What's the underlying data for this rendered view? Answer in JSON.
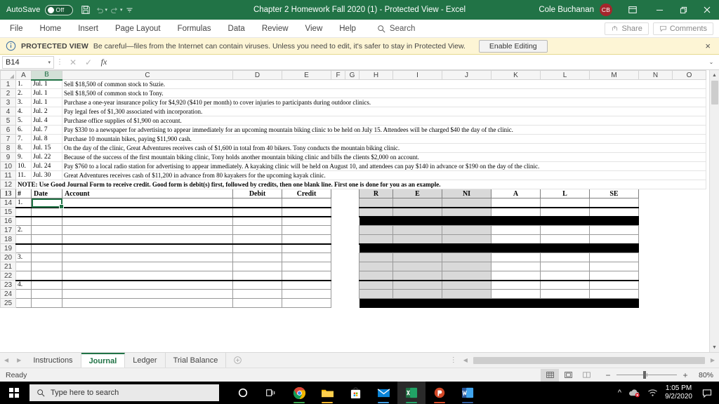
{
  "titlebar": {
    "autosave_label": "AutoSave",
    "autosave_state": "Off",
    "document_title": "Chapter 2 Homework Fall 2020 (1)  -  Protected View  -  Excel",
    "user_name": "Cole Buchanan",
    "user_initials": "CB",
    "icons": [
      "save-icon",
      "undo-icon",
      "redo-icon",
      "customize-quick-access-icon"
    ],
    "window_buttons": [
      "ribbon-display-options",
      "minimize",
      "restore",
      "close"
    ]
  },
  "menubar": {
    "items": [
      "File",
      "Home",
      "Insert",
      "Page Layout",
      "Formulas",
      "Data",
      "Review",
      "View",
      "Help"
    ],
    "search_label": "Search",
    "share_label": "Share",
    "comments_label": "Comments"
  },
  "protected_view": {
    "badge": "PROTECTED VIEW",
    "message": "Be careful—files from the Internet can contain viruses. Unless you need to edit, it's safer to stay in Protected View.",
    "button_label": "Enable Editing",
    "close_label": "×"
  },
  "formula_bar": {
    "name_box": "B14",
    "cancel": "✕",
    "enter": "✓",
    "function": "fx",
    "value": "",
    "placeholder": ""
  },
  "grid": {
    "columns": [
      "A",
      "B",
      "C",
      "D",
      "E",
      "F",
      "G",
      "H",
      "I",
      "J",
      "K",
      "L",
      "M",
      "N",
      "O"
    ],
    "selected_column": "B",
    "active_cell": "B14",
    "row_numbers": [
      1,
      2,
      3,
      4,
      5,
      6,
      7,
      8,
      9,
      10,
      11,
      12,
      13,
      14,
      15,
      16,
      17,
      18,
      19,
      20,
      21,
      22,
      23,
      24,
      25
    ],
    "transactions": [
      {
        "row": 1,
        "num": "1.",
        "date": "Jul. 1",
        "text": "Sell $18,500 of common stock to Suzie."
      },
      {
        "row": 2,
        "num": "2.",
        "date": "Jul. 1",
        "text": "Sell $18,500 of common stock to Tony."
      },
      {
        "row": 3,
        "num": "3.",
        "date": "Jul. 1",
        "text": "Purchase a one-year insurance policy for $4,920 ($410 per month) to cover injuries to participants during outdoor clinics."
      },
      {
        "row": 4,
        "num": "4.",
        "date": "Jul. 2",
        "text": "Pay legal fees of $1,300 associated with incorporation."
      },
      {
        "row": 5,
        "num": "5.",
        "date": "Jul. 4",
        "text": "Purchase office supplies of $1,900 on account."
      },
      {
        "row": 6,
        "num": "6.",
        "date": "Jul. 7",
        "text": "Pay $330 to a newspaper for advertising to appear immediately for an upcoming mountain biking clinic to be held on July 15. Attendees will be charged $40 the day of the clinic."
      },
      {
        "row": 7,
        "num": "7.",
        "date": "Jul. 8",
        "text": "Purchase 10 mountain bikes, paying $11,900 cash."
      },
      {
        "row": 8,
        "num": "8.",
        "date": "Jul. 15",
        "text": "On the day of the clinic, Great Adventures receives cash of $1,600 in total from 40 bikers. Tony conducts the mountain biking clinic."
      },
      {
        "row": 9,
        "num": "9.",
        "date": "Jul. 22",
        "text": "Because of the success of the first mountain biking clinic, Tony holds another mountain biking clinic and bills the clients $2,000 on account."
      },
      {
        "row": 10,
        "num": "10.",
        "date": "Jul. 24",
        "text": "Pay $760 to a local radio station for advertising to appear immediately. A kayaking clinic will be held on August 10, and attendees can pay $140 in advance or $190 on the day of the clinic."
      },
      {
        "row": 11,
        "num": "11.",
        "date": "Jul. 30",
        "text": "Great Adventures receives cash of $11,200 in advance from 80 kayakers for the upcoming kayak clinic."
      }
    ],
    "note": "NOTE: Use Good Journal Form to receive credit. Good form is debit(s) first, followed by credits, then one blank line. First one is done for you as an example.",
    "journal_headers": {
      "num": "#",
      "date": "Date",
      "account": "Account",
      "debit": "Debit",
      "credit": "Credit",
      "r": "R",
      "e": "E",
      "ni": "NI",
      "a": "A",
      "l": "L",
      "se": "SE"
    },
    "journal_rows": [
      {
        "row": 14,
        "num": "1.",
        "kind": "entry",
        "thick_bottom": true
      },
      {
        "row": 15,
        "num": "",
        "kind": "entry",
        "thick_bottom": true
      },
      {
        "row": 16,
        "num": "",
        "kind": "black"
      },
      {
        "row": 17,
        "num": "2.",
        "kind": "entry",
        "thick_bottom": false
      },
      {
        "row": 18,
        "num": "",
        "kind": "entry",
        "thick_bottom": true
      },
      {
        "row": 19,
        "num": "",
        "kind": "black"
      },
      {
        "row": 20,
        "num": "3.",
        "kind": "entry",
        "thick_bottom": false
      },
      {
        "row": 21,
        "num": "",
        "kind": "entry",
        "thick_bottom": false
      },
      {
        "row": 22,
        "num": "",
        "kind": "entry",
        "thick_bottom": true
      },
      {
        "row": 23,
        "num": "4.",
        "kind": "entry",
        "thick_bottom": false
      },
      {
        "row": 24,
        "num": "",
        "kind": "entry",
        "thick_bottom": false
      },
      {
        "row": 25,
        "num": "",
        "kind": "black"
      }
    ]
  },
  "sheet_tabs": {
    "tabs": [
      "Instructions",
      "Journal",
      "Ledger",
      "Trial Balance"
    ],
    "active": "Journal",
    "add_label": "+"
  },
  "status_bar": {
    "status": "Ready",
    "views": [
      "normal-view",
      "page-layout-view",
      "page-break-view"
    ],
    "active_view": "normal-view",
    "zoom_out": "−",
    "zoom_in": "+",
    "zoom_level": "80%"
  },
  "taskbar": {
    "search_placeholder": "Type here to search",
    "apps": [
      "cortana-icon",
      "task-view-icon",
      "chrome-icon",
      "file-explorer-icon",
      "microsoft-store-icon",
      "mail-icon",
      "excel-icon",
      "powerpoint-icon",
      "word-icon"
    ],
    "time": "1:05 PM",
    "date": "9/2/2020"
  },
  "colors": {
    "excel_green": "#217346",
    "protected_yellow": "#fdf5d5",
    "avatar_red": "#a4262c",
    "shade_gray": "#d9d9d9"
  }
}
